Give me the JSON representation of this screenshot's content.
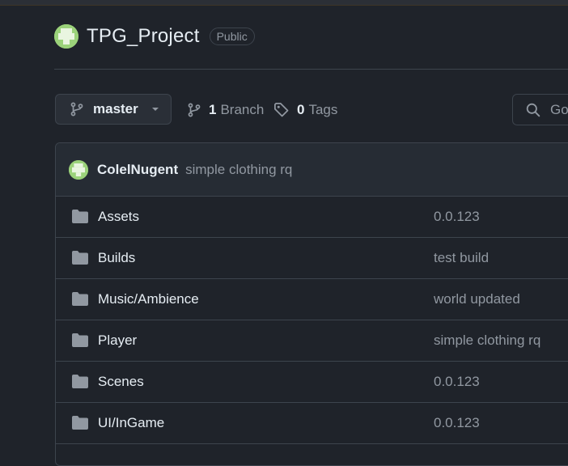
{
  "repo": {
    "name": "TPG_Project",
    "visibility": "Public"
  },
  "toolbar": {
    "branch_label": "master",
    "branch_count": "1",
    "branch_word": "Branch",
    "tag_count": "0",
    "tag_word": "Tags",
    "search_text": "Go"
  },
  "latest_commit": {
    "author": "ColelNugent",
    "message": "simple clothing rq"
  },
  "files": [
    {
      "name": "Assets",
      "message": "0.0.123"
    },
    {
      "name": "Builds",
      "message": "test build"
    },
    {
      "name": "Music/Ambience",
      "message": "world updated"
    },
    {
      "name": "Player",
      "message": "simple clothing rq"
    },
    {
      "name": "Scenes",
      "message": "0.0.123"
    },
    {
      "name": "UI/InGame",
      "message": "0.0.123"
    }
  ],
  "colors": {
    "background": "#1f232a",
    "border": "#3d444d",
    "text_primary": "#e6edf3",
    "text_muted": "#9198a1",
    "avatar": "#9bd27a",
    "folder": "#9198a1"
  },
  "icons": {
    "branch": "git-branch-icon",
    "tag": "tag-icon",
    "search": "search-icon",
    "folder": "folder-icon",
    "caret": "caret-down-icon"
  }
}
